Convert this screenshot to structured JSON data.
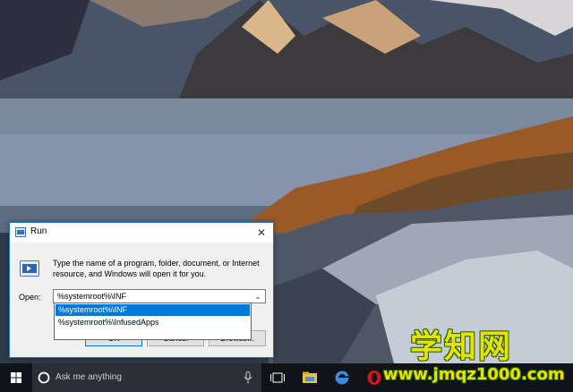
{
  "run_dialog": {
    "title": "Run",
    "close_glyph": "✕",
    "description": "Type the name of a program, folder, document, or Internet resource, and Windows will open it for you.",
    "open_label": "Open:",
    "open_value": "%systemroot%\\INF",
    "dropdown_arrow": "⌄",
    "buttons": {
      "ok": "OK",
      "cancel": "Cancel",
      "browse": "Browse..."
    }
  },
  "autocomplete": {
    "items": [
      {
        "text": "%systemroot%\\INF",
        "selected": true
      },
      {
        "text": "%systemroot%\\InfusedApps",
        "selected": false
      }
    ]
  },
  "taskbar": {
    "search_placeholder": "Ask me anything",
    "icons": [
      "windows-start-icon",
      "cortana-icon",
      "microphone-icon",
      "task-view-icon",
      "file-explorer-icon",
      "edge-icon",
      "opera-icon"
    ]
  },
  "watermark": {
    "title": "学知网",
    "url": "www.jmqz1000.com"
  },
  "colors": {
    "accent": "#0078d7",
    "taskbar": "#101419",
    "watermark": "#e8e200"
  }
}
